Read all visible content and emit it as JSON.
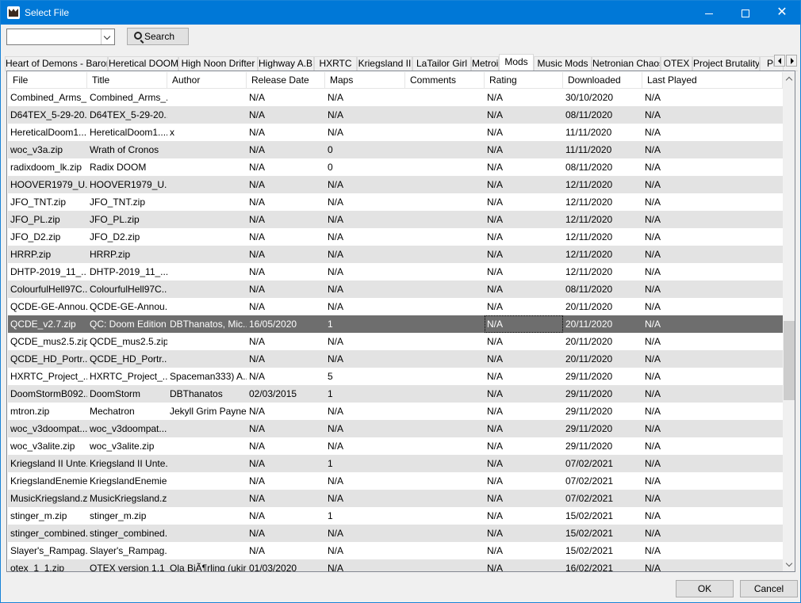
{
  "window": {
    "title": "Select File",
    "accent": "#0078d7"
  },
  "toolbar": {
    "search_value": "",
    "search_label": "Search"
  },
  "tabs": [
    {
      "label": "Heart of Demons - Baron"
    },
    {
      "label": "Heretical DOOM"
    },
    {
      "label": "High Noon Drifter"
    },
    {
      "label": "Highway A.B."
    },
    {
      "label": "HXRTC"
    },
    {
      "label": "Kriegsland II"
    },
    {
      "label": "LaTailor Girl"
    },
    {
      "label": "Metroid"
    },
    {
      "label": "Mods",
      "active": true
    },
    {
      "label": "Music Mods"
    },
    {
      "label": "Netronian Chaos"
    },
    {
      "label": "OTEX"
    },
    {
      "label": "Project Brutality"
    },
    {
      "label": "Pr"
    }
  ],
  "columns": [
    "File",
    "Title",
    "Author",
    "Release Date",
    "Maps",
    "Comments",
    "Rating",
    "Downloaded",
    "Last Played"
  ],
  "rows": [
    [
      "Combined_Arms_...",
      "Combined_Arms_...",
      "",
      "N/A",
      "N/A",
      "",
      "N/A",
      "30/10/2020",
      "N/A"
    ],
    [
      "D64TEX_5-29-20...",
      "D64TEX_5-29-20...",
      "",
      "N/A",
      "N/A",
      "",
      "N/A",
      "08/11/2020",
      "N/A"
    ],
    [
      "HereticalDoom1....",
      "HereticalDoom1....",
      "x",
      "N/A",
      "N/A",
      "",
      "N/A",
      "11/11/2020",
      "N/A"
    ],
    [
      "woc_v3a.zip",
      "Wrath of Cronos",
      "",
      "N/A",
      "0",
      "",
      "N/A",
      "11/11/2020",
      "N/A"
    ],
    [
      "radixdoom_lk.zip",
      "Radix DOOM",
      "",
      "N/A",
      "0",
      "",
      "N/A",
      "08/11/2020",
      "N/A"
    ],
    [
      "HOOVER1979_U...",
      "HOOVER1979_U...",
      "",
      "N/A",
      "N/A",
      "",
      "N/A",
      "12/11/2020",
      "N/A"
    ],
    [
      "JFO_TNT.zip",
      "JFO_TNT.zip",
      "",
      "N/A",
      "N/A",
      "",
      "N/A",
      "12/11/2020",
      "N/A"
    ],
    [
      "JFO_PL.zip",
      "JFO_PL.zip",
      "",
      "N/A",
      "N/A",
      "",
      "N/A",
      "12/11/2020",
      "N/A"
    ],
    [
      "JFO_D2.zip",
      "JFO_D2.zip",
      "",
      "N/A",
      "N/A",
      "",
      "N/A",
      "12/11/2020",
      "N/A"
    ],
    [
      "HRRP.zip",
      "HRRP.zip",
      "",
      "N/A",
      "N/A",
      "",
      "N/A",
      "12/11/2020",
      "N/A"
    ],
    [
      "DHTP-2019_11_...",
      "DHTP-2019_11_...",
      "",
      "N/A",
      "N/A",
      "",
      "N/A",
      "12/11/2020",
      "N/A"
    ],
    [
      "ColourfulHell97C...",
      "ColourfulHell97C...",
      "",
      "N/A",
      "N/A",
      "",
      "N/A",
      "08/11/2020",
      "N/A"
    ],
    [
      "QCDE-GE-Annou...",
      "QCDE-GE-Annou...",
      "",
      "N/A",
      "N/A",
      "",
      "N/A",
      "20/11/2020",
      "N/A"
    ],
    [
      "QCDE_v2.7.zip",
      "QC: Doom Edition",
      "DBThanatos, Mic...",
      "16/05/2020",
      "1",
      "",
      "N/A",
      "20/11/2020",
      "N/A"
    ],
    [
      "QCDE_mus2.5.zip",
      "QCDE_mus2.5.zip",
      "",
      "N/A",
      "N/A",
      "",
      "N/A",
      "20/11/2020",
      "N/A"
    ],
    [
      "QCDE_HD_Portr...",
      "QCDE_HD_Portr...",
      "",
      "N/A",
      "N/A",
      "",
      "N/A",
      "20/11/2020",
      "N/A"
    ],
    [
      "HXRTC_Project_...",
      "HXRTC_Project_...",
      "Spaceman333) A...",
      "N/A",
      "5",
      "",
      "N/A",
      "29/11/2020",
      "N/A"
    ],
    [
      "DoomStormB092....",
      "DoomStorm",
      "DBThanatos",
      "02/03/2015",
      "1",
      "",
      "N/A",
      "29/11/2020",
      "N/A"
    ],
    [
      "mtron.zip",
      "Mechatron",
      "Jekyll Grim Payne...",
      "N/A",
      "N/A",
      "",
      "N/A",
      "29/11/2020",
      "N/A"
    ],
    [
      "woc_v3doompat...",
      "woc_v3doompat...",
      "",
      "N/A",
      "N/A",
      "",
      "N/A",
      "29/11/2020",
      "N/A"
    ],
    [
      "woc_v3alite.zip",
      "woc_v3alite.zip",
      "",
      "N/A",
      "N/A",
      "",
      "N/A",
      "29/11/2020",
      "N/A"
    ],
    [
      "Kriegsland II Unte...",
      "Kriegsland II Unte...",
      "",
      "N/A",
      "1",
      "",
      "N/A",
      "07/02/2021",
      "N/A"
    ],
    [
      "KriegslandEnemie...",
      "KriegslandEnemie...",
      "",
      "N/A",
      "N/A",
      "",
      "N/A",
      "07/02/2021",
      "N/A"
    ],
    [
      "MusicKriegsland.zip",
      "MusicKriegsland.zip",
      "",
      "N/A",
      "N/A",
      "",
      "N/A",
      "07/02/2021",
      "N/A"
    ],
    [
      "stinger_m.zip",
      "stinger_m.zip",
      "",
      "N/A",
      "1",
      "",
      "N/A",
      "15/02/2021",
      "N/A"
    ],
    [
      "stinger_combined...",
      "stinger_combined...",
      "",
      "N/A",
      "N/A",
      "",
      "N/A",
      "15/02/2021",
      "N/A"
    ],
    [
      "Slayer's_Rampag...",
      "Slayer's_Rampag...",
      "",
      "N/A",
      "N/A",
      "",
      "N/A",
      "15/02/2021",
      "N/A"
    ],
    [
      "otex_1_1.zip",
      "OTEX version 1.1",
      "Ola BjÃ¶rling (ukiro)",
      "01/03/2020",
      "N/A",
      "",
      "N/A",
      "16/02/2021",
      "N/A"
    ]
  ],
  "selected_row": 13,
  "footer": {
    "ok_label": "OK",
    "cancel_label": "Cancel"
  }
}
